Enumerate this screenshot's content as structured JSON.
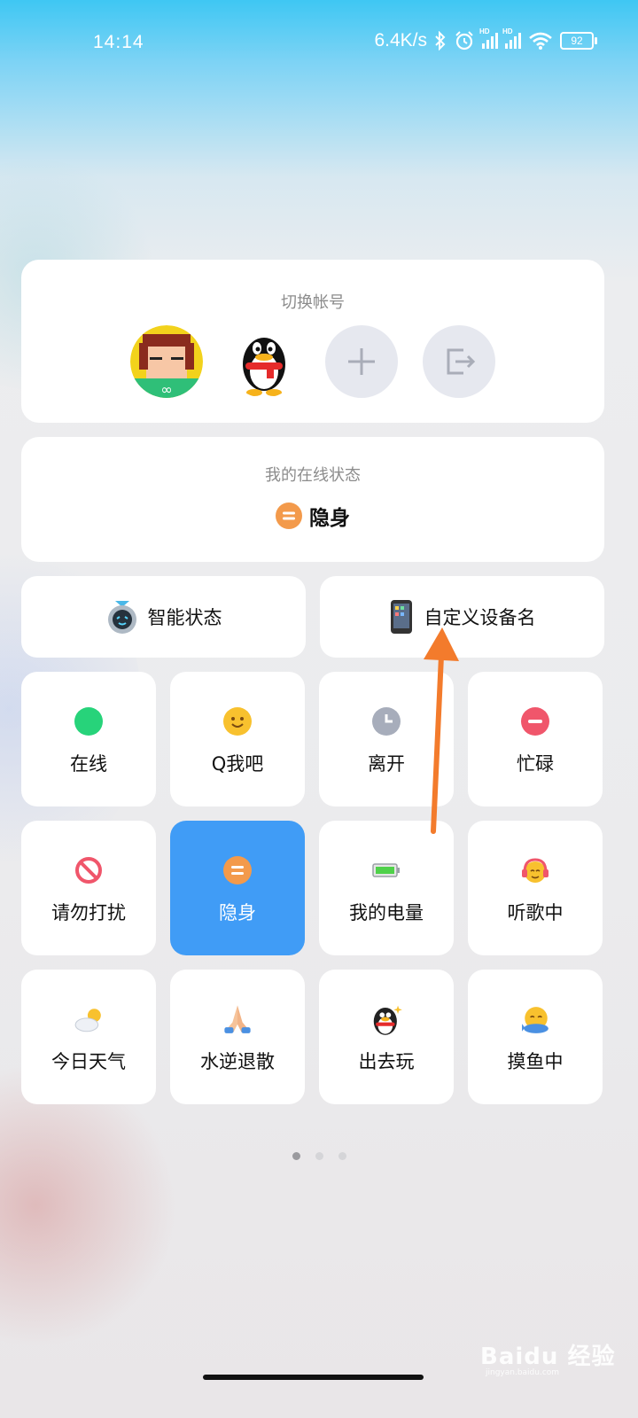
{
  "status_bar": {
    "time": "14:14",
    "net_speed": "6.4K/s",
    "battery": "92",
    "hd1": "HD",
    "hd2": "HD"
  },
  "switch_account": {
    "title": "切换帐号"
  },
  "online_status": {
    "title": "我的在线状态",
    "value": "隐身"
  },
  "quick": {
    "smart_status": "智能状态",
    "custom_device": "自定义设备名"
  },
  "statuses": [
    {
      "label": "在线",
      "icon": "green-dot-icon"
    },
    {
      "label": "Q我吧",
      "icon": "smile-icon"
    },
    {
      "label": "离开",
      "icon": "clock-icon"
    },
    {
      "label": "忙碌",
      "icon": "minus-circle-icon"
    },
    {
      "label": "请勿打扰",
      "icon": "no-entry-icon"
    },
    {
      "label": "隐身",
      "icon": "invisible-icon",
      "selected": true
    },
    {
      "label": "我的电量",
      "icon": "battery-icon"
    },
    {
      "label": "听歌中",
      "icon": "headphones-face-icon"
    },
    {
      "label": "今日天气",
      "icon": "weather-icon"
    },
    {
      "label": "水逆退散",
      "icon": "praying-hands-icon"
    },
    {
      "label": "出去玩",
      "icon": "penguin-icon"
    },
    {
      "label": "摸鱼中",
      "icon": "fish-face-icon"
    }
  ],
  "pagination": {
    "total": 3,
    "current": 1
  },
  "watermark": {
    "brand": "Baidu 经验",
    "url": "jingyan.baidu.com"
  },
  "colors": {
    "selected_tile": "#409cf6",
    "invisible": "#f39a4b",
    "online": "#27d37a",
    "busy": "#f0566b",
    "arrow": "#f37b2c"
  }
}
